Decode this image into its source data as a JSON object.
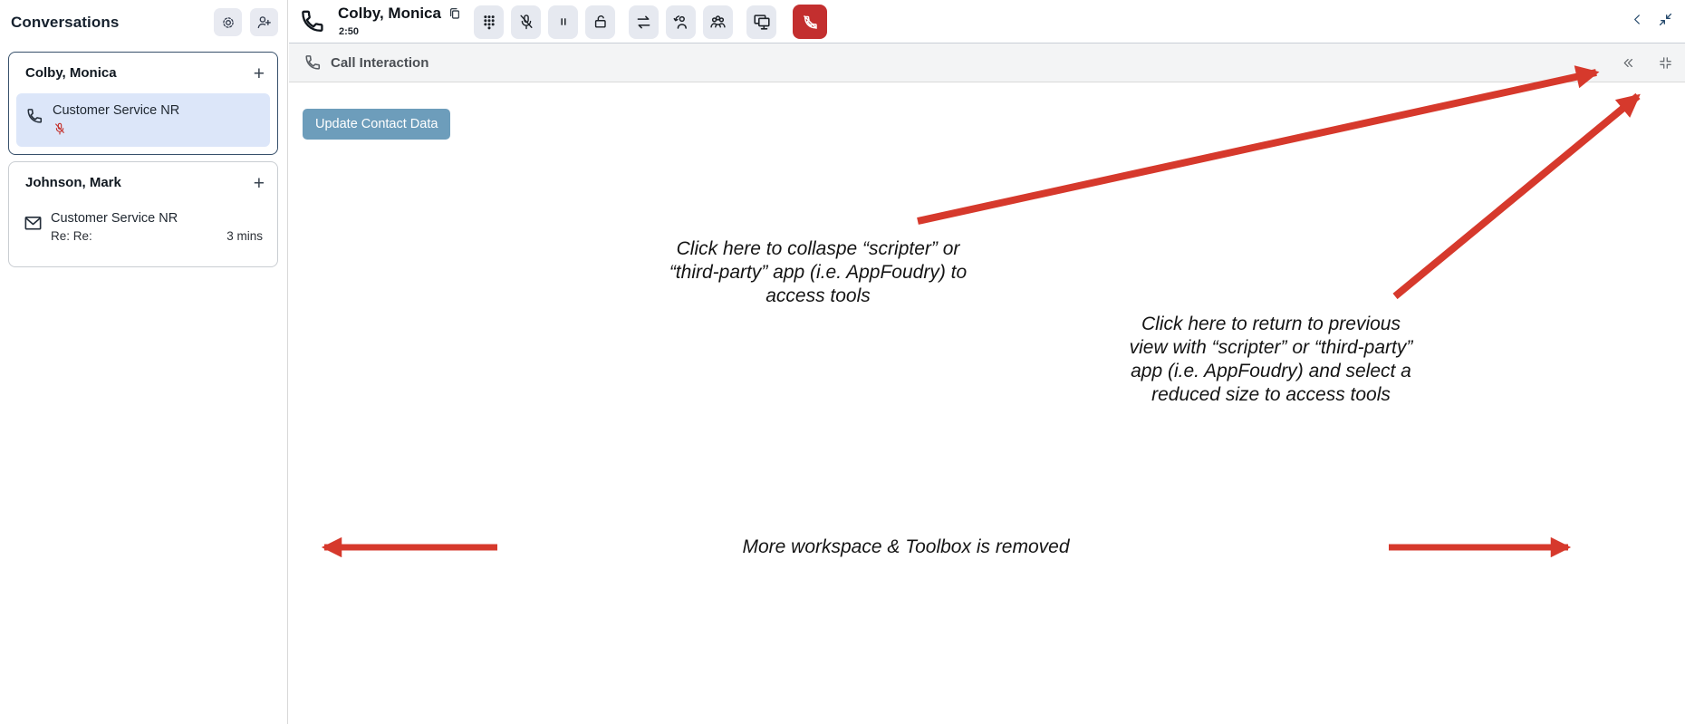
{
  "sidebar": {
    "title": "Conversations",
    "header_icons": [
      "settings-icon",
      "add-person-icon"
    ],
    "cards": [
      {
        "name": "Colby, Monica",
        "add_label": "+",
        "interaction": {
          "queue": "Customer Service NR",
          "type_icon": "phone-icon",
          "status_icon": "mic-muted-icon",
          "selected": true
        }
      },
      {
        "name": "Johnson, Mark",
        "add_label": "+",
        "interaction": {
          "queue": "Customer Service NR",
          "subject": "Re: Re:",
          "time": "3 mins",
          "type_icon": "email-icon",
          "selected": false
        }
      }
    ]
  },
  "call_header": {
    "caller_name": "Colby, Monica",
    "timer": "2:50",
    "controls": [
      "dialpad",
      "mute",
      "hold",
      "secure-pause",
      "transfer",
      "consult",
      "conference",
      "screen-pop",
      "end-call"
    ]
  },
  "window_controls": [
    "back-icon",
    "collapse-diagonal-icon"
  ],
  "interaction_panel": {
    "title": "Call Interaction",
    "icons": [
      "double-chevron-left-icon",
      "compress-icon"
    ],
    "update_button_label": "Update Contact Data"
  },
  "annotations": {
    "collapse_note": {
      "lines": [
        "Click here to collaspe “scripter” or",
        "“third-party” app (i.e. AppFoudry) to",
        "access tools"
      ]
    },
    "return_note": {
      "lines": [
        "Click here to return to previous",
        "view with “scripter” or “third-party”",
        "app (i.e. AppFoudry) and select a",
        "reduced size to access tools"
      ]
    },
    "workspace_note": "More workspace & Toolbox is removed"
  },
  "colors": {
    "annotation_red": "#d6392c",
    "primary_button": "#6d9dbb",
    "selected_row": "#dce6f9",
    "end_call_red": "#c32f2f",
    "control_bg": "#e6e9f0",
    "card_selected_border": "#37506b"
  }
}
